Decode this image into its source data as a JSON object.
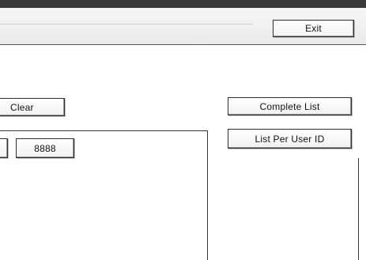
{
  "toolbar": {
    "exit_label": "Exit"
  },
  "actions": {
    "clear_label": "Clear",
    "complete_list_label": "Complete List",
    "list_per_user_label": "List Per User ID"
  },
  "user_ids": {
    "visible_items": [
      "8888"
    ]
  },
  "colors": {
    "frame": "#3a3a3a",
    "header_bg": "#e9e9e9",
    "button_border": "#2f2f2f"
  }
}
